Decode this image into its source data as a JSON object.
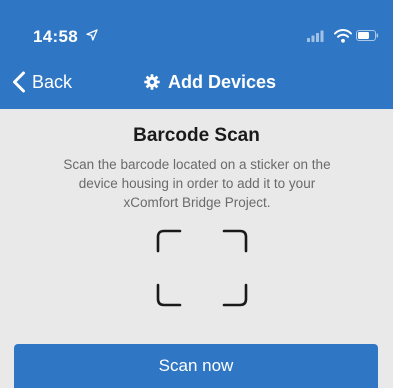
{
  "status_bar": {
    "time": "14:58"
  },
  "nav": {
    "back_label": "Back",
    "title": "Add Devices"
  },
  "scan": {
    "title": "Barcode Scan",
    "description": "Scan the barcode located on a sticker on the device housing in order to add it to your xComfort Bridge Project.",
    "button_label": "Scan now"
  },
  "colors": {
    "brand_blue": "#2f77c4",
    "background": "#e9e9e9"
  },
  "icons": {
    "location": "location-arrow-icon",
    "signal": "cellular-signal-icon",
    "wifi": "wifi-icon",
    "battery": "battery-icon",
    "back": "chevron-left-icon",
    "title": "gear-icon",
    "frame": "scan-frame-icon"
  }
}
